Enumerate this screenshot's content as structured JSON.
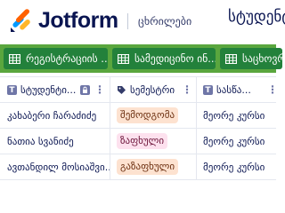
{
  "header": {
    "logo_text": "Jotform",
    "subtitle": "ცხრილები",
    "page_title": "სტუდენტ"
  },
  "tabs": [
    {
      "label": "რეგისტრაციის ...",
      "icon": "grid-table-icon"
    },
    {
      "label": "სამედიცინო ინ...",
      "icon": "grid-table-icon"
    },
    {
      "label": "საცხოვრ",
      "icon": "grid-table-icon"
    }
  ],
  "columns": [
    {
      "label": "სტუდენტი...",
      "type_icon": "T",
      "icon": "text-type-icon"
    },
    {
      "label": "სემესტრი",
      "type_icon": "tag",
      "icon": "tag-type-icon"
    },
    {
      "label": "სასწა...",
      "type_icon": "T",
      "icon": "text-type-icon"
    }
  ],
  "rows": [
    {
      "student": "კახაბერი ჩარაძიძე",
      "semester": "შემოდგომა",
      "semester_color": "#fde2d0",
      "semester_text_color": "#6b2e0f",
      "course": "მეორე კურსი"
    },
    {
      "student": "ნათია სვანიძე",
      "semester": "ზაფხული",
      "semester_color": "#fde1ee",
      "semester_text_color": "#6b1238",
      "course": "მეორე კურსი"
    },
    {
      "student": "ავთანდილ მოსიაშვი...",
      "semester": "გაზაფხული",
      "semester_color": "#fde2d0",
      "semester_text_color": "#6b2e0f",
      "course": "მეორე კურსი"
    }
  ],
  "colors": {
    "brand_navy": "#0a1551",
    "tabbar_bg": "#5aa63e",
    "tab_bg": "#23813b",
    "logo_orange": "#ff6100",
    "logo_yellow": "#ffb629",
    "logo_blue": "#0099ff"
  }
}
